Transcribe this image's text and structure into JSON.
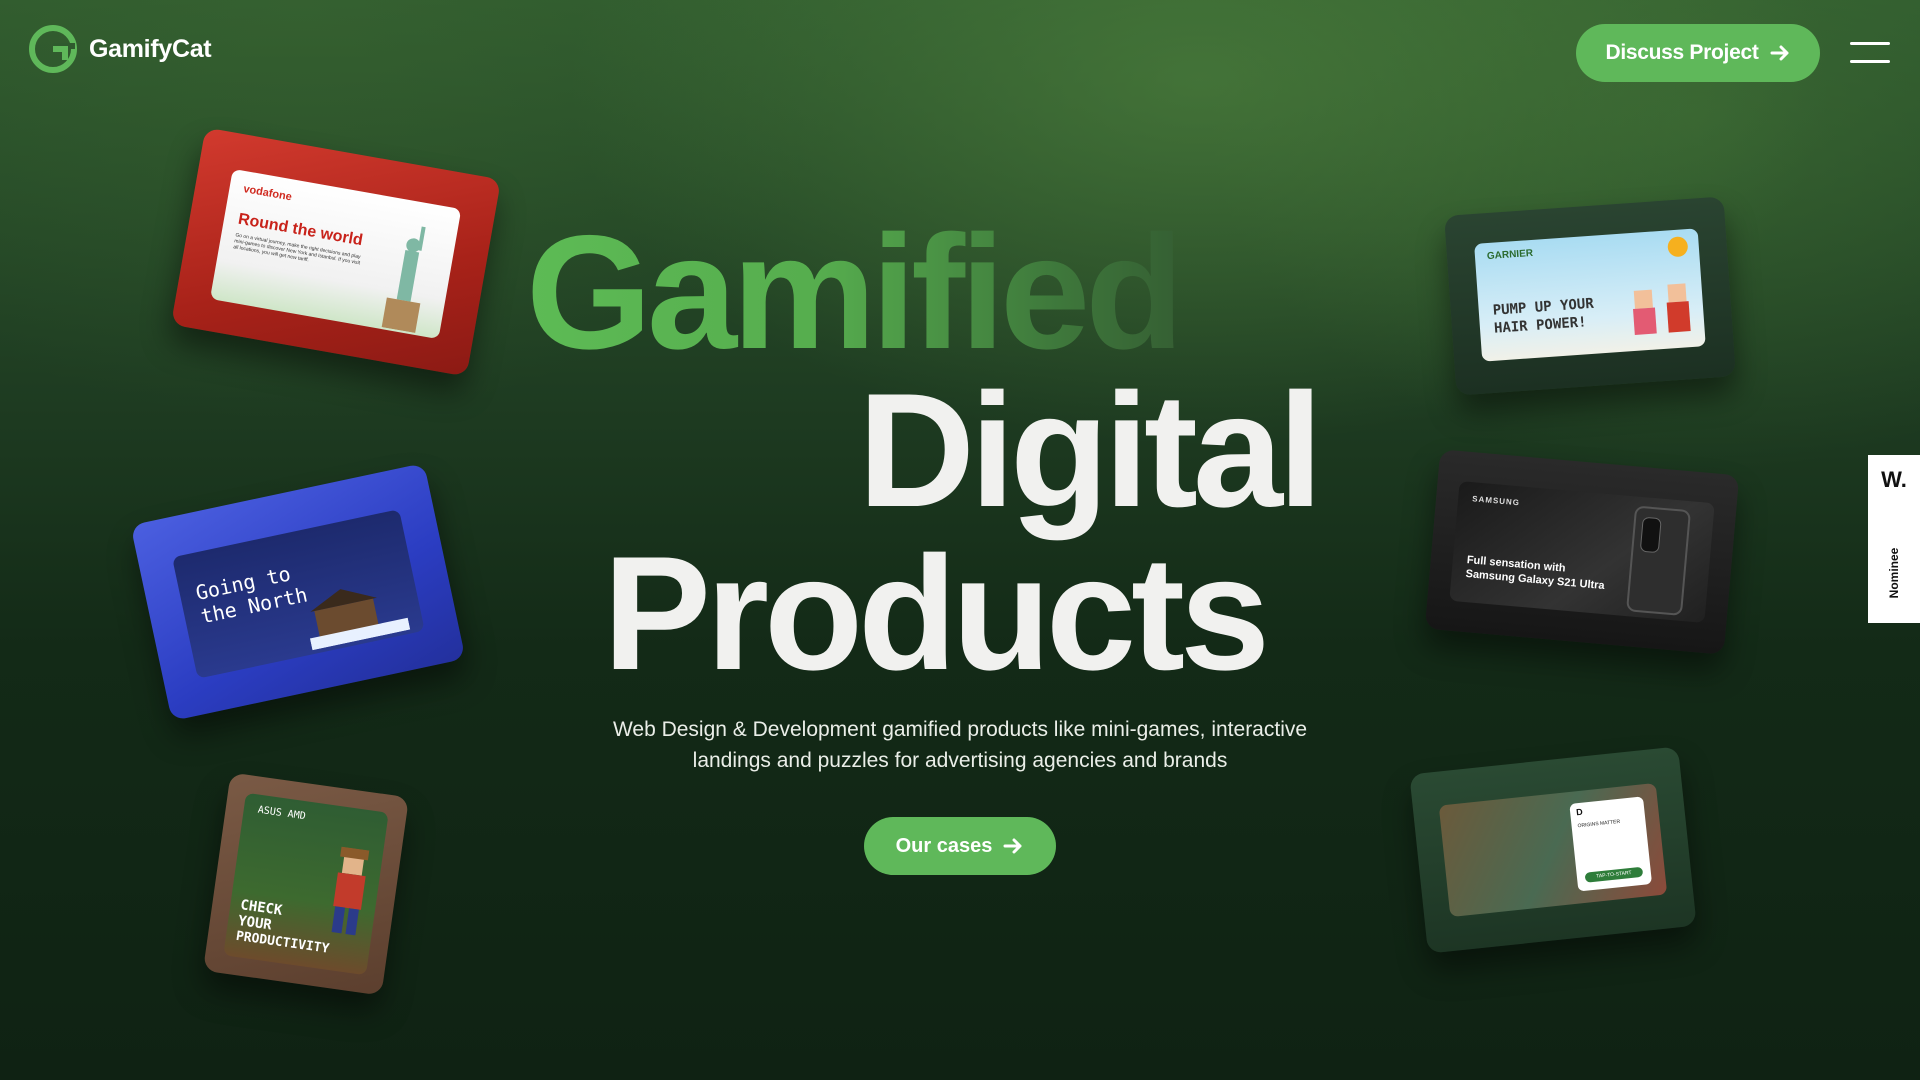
{
  "brand": {
    "name": "GamifyCat",
    "logo_icon": "g-logo-icon",
    "accent": "#5fb85a"
  },
  "header": {
    "cta_label": "Discuss Project",
    "menu_icon": "hamburger-icon"
  },
  "hero": {
    "line1": "Gamified",
    "line2": "Digital",
    "line3": "Products",
    "subtitle_line1": "Web Design & Development gamified products like mini-games, interactive",
    "subtitle_line2": "landings and puzzles for advertising agencies and brands",
    "cta_label": "Our cases"
  },
  "cartridges": [
    {
      "brand": "vodafone",
      "title": "Round the world",
      "body": "Go on a virtual journey, make the right decisions and play mini-games to discover New York and Istanbul. If you visit all locations, you will get new tariff."
    },
    {
      "title_line1": "Going to",
      "title_line2": "the North"
    },
    {
      "brand": "ASUS  AMD",
      "title_line1": "CHECK",
      "title_line2": "YOUR",
      "title_line3": "PRODUCTIVITY"
    },
    {
      "brand": "GARNIER",
      "title_line1": "PUMP UP YOUR",
      "title_line2": "HAIR POWER!"
    },
    {
      "brand": "SAMSUNG",
      "title_line1": "Full sensation with",
      "title_line2": "Samsung Galaxy S21 Ultra"
    },
    {
      "brand": "D",
      "card_title": "ORIGINS MATTER",
      "button": "TAP-TO-START"
    }
  ],
  "side_badge": {
    "logo": "W.",
    "label": "Nominee"
  }
}
